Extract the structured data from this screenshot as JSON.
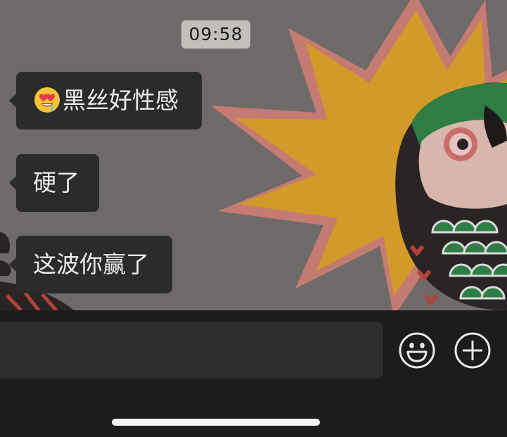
{
  "chat": {
    "timestamp": "09:58",
    "messages": [
      {
        "emoji": "heart-eyes-drool-emoji",
        "text": "黑丝好性感"
      },
      {
        "text": "硬了"
      },
      {
        "text": "这波你赢了"
      }
    ]
  },
  "composer": {
    "value": "",
    "placeholder": ""
  },
  "icons": {
    "emoji_button": "smiley-face-icon",
    "more_button": "plus-circle-icon"
  },
  "colors": {
    "bubble": "#2b2b2b",
    "bubble_text": "#ececec",
    "time_badge": "#c2bfbd",
    "input_bar": "#1d1c1c",
    "wallpaper_star_yellow": "#e2a418",
    "wallpaper_star_outline": "#d98576"
  }
}
